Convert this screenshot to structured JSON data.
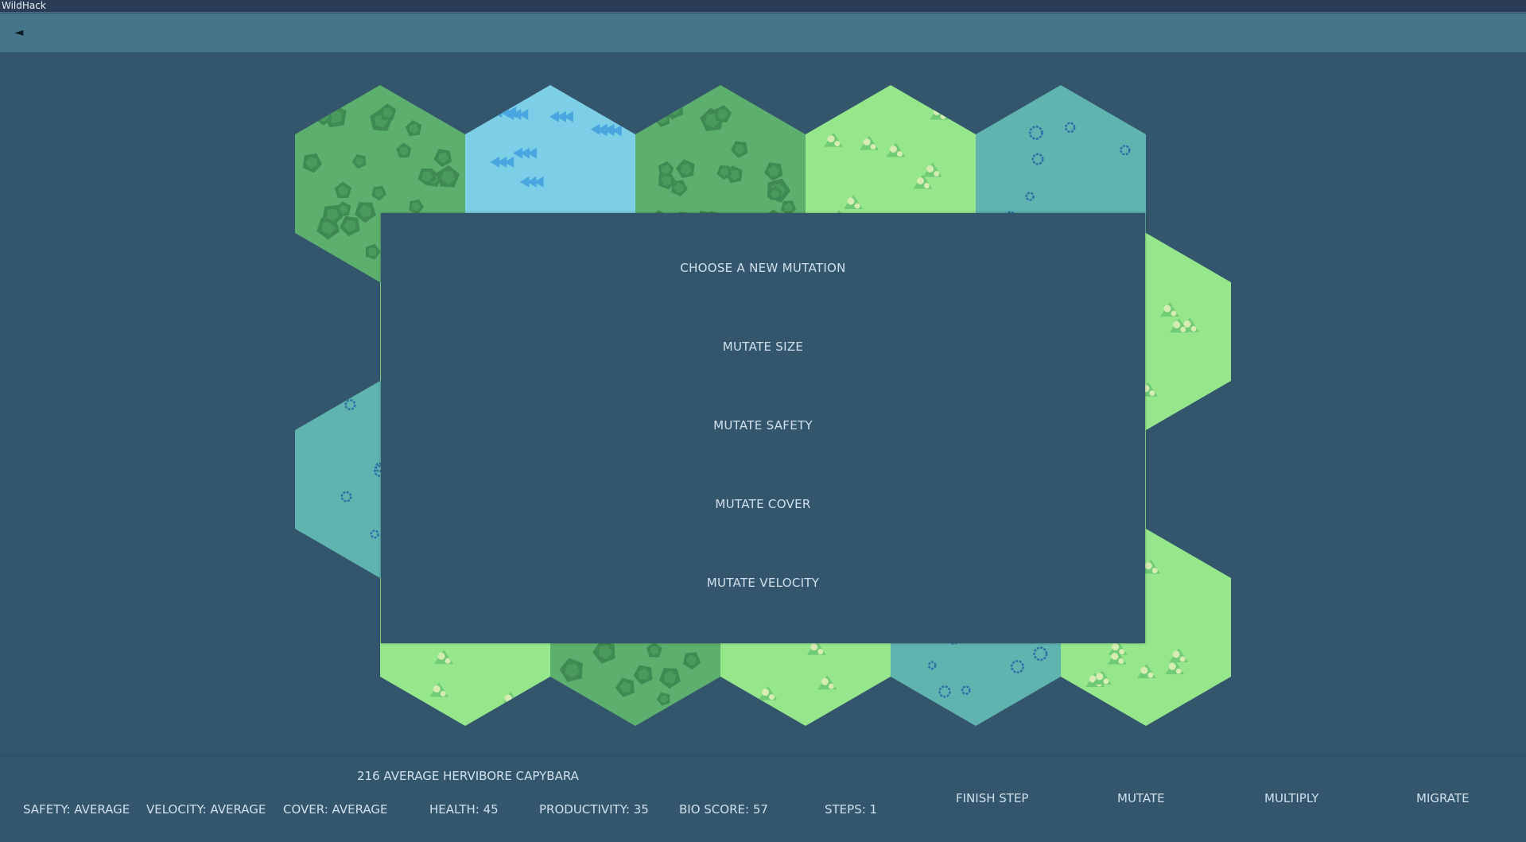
{
  "window": {
    "title": "WildHack"
  },
  "topbar": {
    "back_icon": "◄"
  },
  "map": {
    "tiles": [
      {
        "row": 0,
        "col": 0,
        "terrain": "forest"
      },
      {
        "row": 0,
        "col": 1,
        "terrain": "ice"
      },
      {
        "row": 0,
        "col": 2,
        "terrain": "forest"
      },
      {
        "row": 0,
        "col": 3,
        "terrain": "meadow"
      },
      {
        "row": 0,
        "col": 4,
        "terrain": "water"
      },
      {
        "row": 1,
        "col": 0,
        "terrain": "meadow"
      },
      {
        "row": 1,
        "col": 1,
        "terrain": "meadow"
      },
      {
        "row": 1,
        "col": 2,
        "terrain": "meadow"
      },
      {
        "row": 1,
        "col": 3,
        "terrain": "meadow"
      },
      {
        "row": 1,
        "col": 4,
        "terrain": "meadow"
      },
      {
        "row": 2,
        "col": 0,
        "terrain": "water"
      },
      {
        "row": 2,
        "col": 1,
        "terrain": "meadow"
      },
      {
        "row": 2,
        "col": 2,
        "terrain": "meadow"
      },
      {
        "row": 2,
        "col": 3,
        "terrain": "meadow"
      },
      {
        "row": 2,
        "col": 4,
        "terrain": "meadow"
      },
      {
        "row": 3,
        "col": 0,
        "terrain": "meadow"
      },
      {
        "row": 3,
        "col": 1,
        "terrain": "forest"
      },
      {
        "row": 3,
        "col": 2,
        "terrain": "meadow"
      },
      {
        "row": 3,
        "col": 3,
        "terrain": "water"
      },
      {
        "row": 3,
        "col": 4,
        "terrain": "meadow"
      }
    ],
    "colors": {
      "forest": "#5daf6e",
      "ice": "#7ccfe7",
      "meadow": "#96e68c",
      "water": "#5fb4b0"
    }
  },
  "modal": {
    "title": "CHOOSE A NEW MUTATION",
    "options": [
      "MUTATE SIZE",
      "MUTATE SAFETY",
      "MUTATE COVER",
      "MUTATE VELOCITY"
    ]
  },
  "species": {
    "name": "216 AVERAGE HERVIBORE CAPYBARA"
  },
  "stats": {
    "safety": "SAFETY: AVERAGE",
    "velocity": "VELOCITY: AVERAGE",
    "cover": "COVER: AVERAGE",
    "health": "HEALTH: 45",
    "productivity": "PRODUCTIVITY: 35",
    "bio_score": "BIO SCORE: 57",
    "steps": "STEPS: 1"
  },
  "actions": {
    "finish_step": "FINISH STEP",
    "mutate": "MUTATE",
    "multiply": "MULTIPLY",
    "migrate": "MIGRATE"
  }
}
